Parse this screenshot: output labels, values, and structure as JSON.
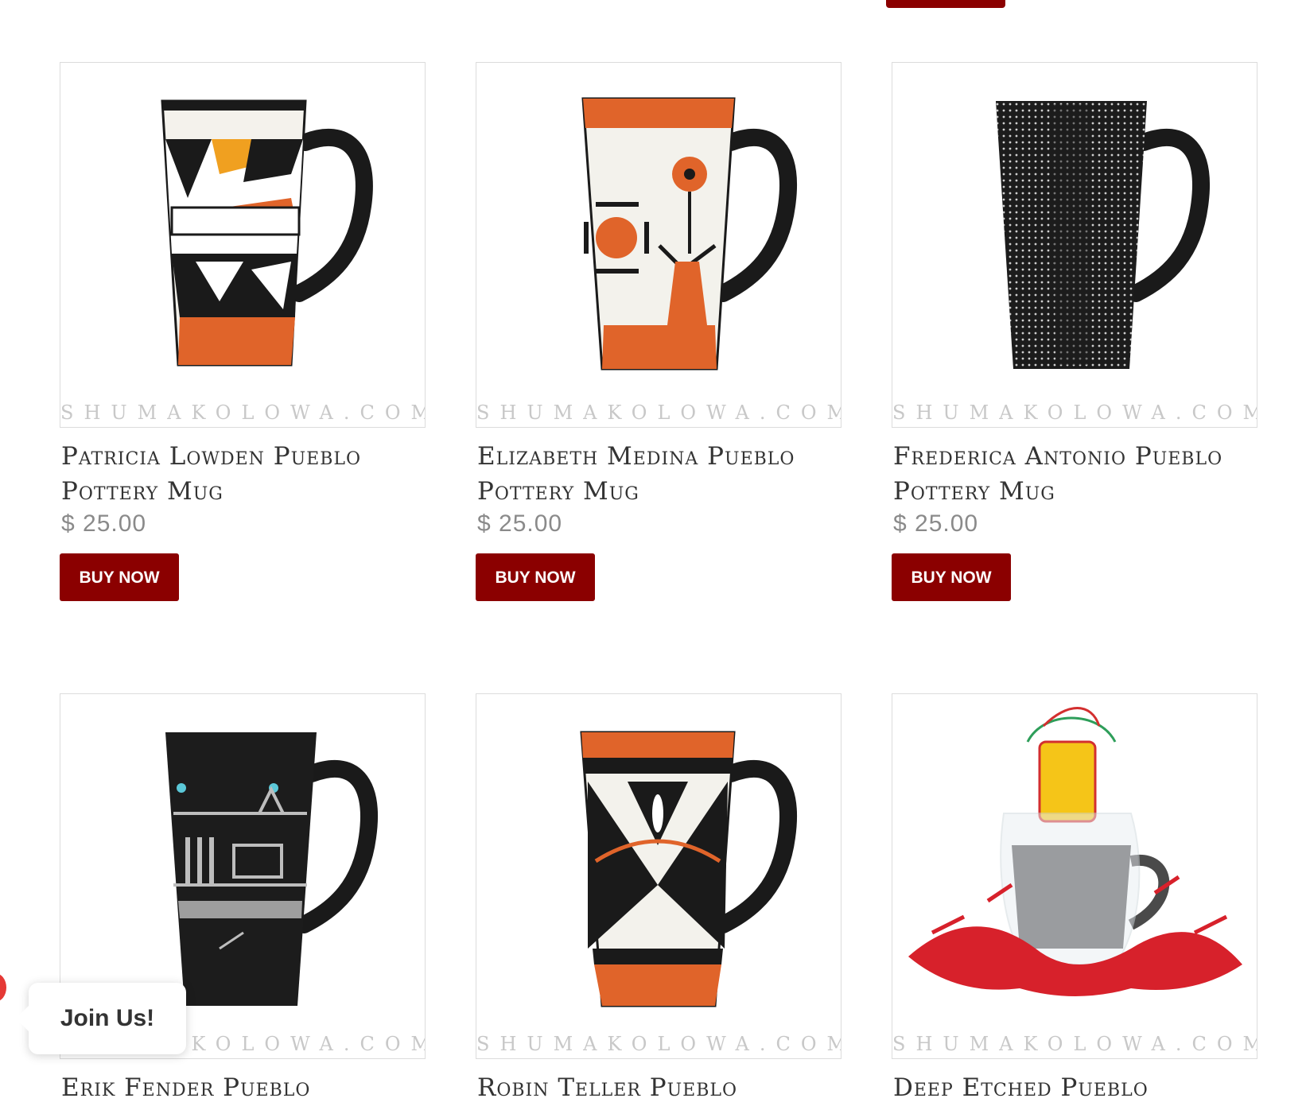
{
  "products": [
    {
      "title": "Patricia Lowden Pueblo Pottery Mug",
      "price": "$ 25.00",
      "button": "BUY NOW",
      "watermark": "SHUMAKOLOWA.COM",
      "icon": "acoma-geometric-mug-image"
    },
    {
      "title": "Elizabeth Medina Pueblo Pottery Mug",
      "price": "$ 25.00",
      "button": "BUY NOW",
      "watermark": "SHUMAKOLOWA.COM",
      "icon": "zia-flower-mug-image"
    },
    {
      "title": "Frederica Antonio Pueblo Pottery Mug",
      "price": "$ 25.00",
      "button": "BUY NOW",
      "watermark": "SHUMAKOLOWA.COM",
      "icon": "black-dotted-mug-image"
    },
    {
      "title": "Erik Fender Pueblo",
      "price": "",
      "button": "",
      "watermark": "SHUMAKOLOWA.COM",
      "icon": "black-silver-mug-image"
    },
    {
      "title": "Robin Teller Pueblo",
      "price": "",
      "button": "",
      "watermark": "SHUMAKOLOWA.COM",
      "icon": "orange-black-mug-image"
    },
    {
      "title": "Deep Etched Pueblo",
      "price": "",
      "button": "",
      "watermark": "SHUMAKOLOWA.COM",
      "icon": "gift-wrapped-mug-image"
    }
  ],
  "join_widget": {
    "label": "Join Us!"
  },
  "colors": {
    "buy_button": "#8b0000",
    "orange": "#e0642a",
    "black": "#1a1a1a"
  }
}
